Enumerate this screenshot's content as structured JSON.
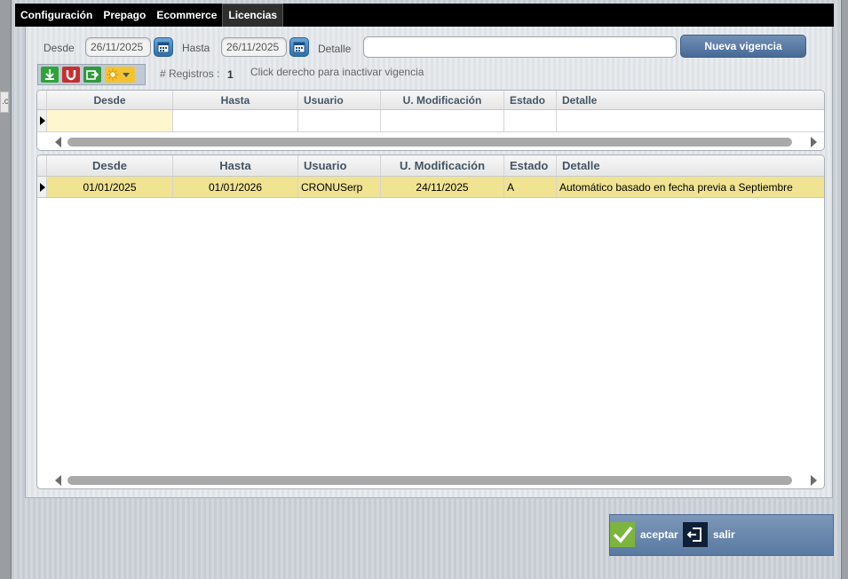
{
  "menu": [
    "Configuración",
    "Prepago",
    "Ecommerce",
    "Licencias"
  ],
  "filter": {
    "desde_label": "Desde",
    "desde_value": "26/11/2025",
    "hasta_label": "Hasta",
    "hasta_value": "26/11/2025",
    "detalle_label": "Detalle",
    "detalle_value": "",
    "new_button": "Nueva vigencia"
  },
  "info": {
    "registros_label": "# Registros :",
    "registros_count": "1",
    "hint": "Click derecho para inactivar vigencia"
  },
  "columns": [
    "Desde",
    "Hasta",
    "Usuario",
    "U. Modificación",
    "Estado",
    "Detalle"
  ],
  "rows": [
    [
      "01/01/2025",
      "01/01/2026",
      "CRONUSerp",
      "24/11/2025",
      "A",
      "Automático basado en fecha previa a Septiembre"
    ]
  ],
  "footer": {
    "accept": "aceptar",
    "exit": "salir"
  },
  "colors": {
    "highlight_row": "#f0e392",
    "edit_cell": "#fdf6cf",
    "menubar": "#000000",
    "button": "#5b7aa1"
  },
  "icons": [
    "download-icon",
    "magnet-icon",
    "export-icon",
    "sun-icon",
    "calendar-icon",
    "check-icon",
    "exit-icon"
  ]
}
